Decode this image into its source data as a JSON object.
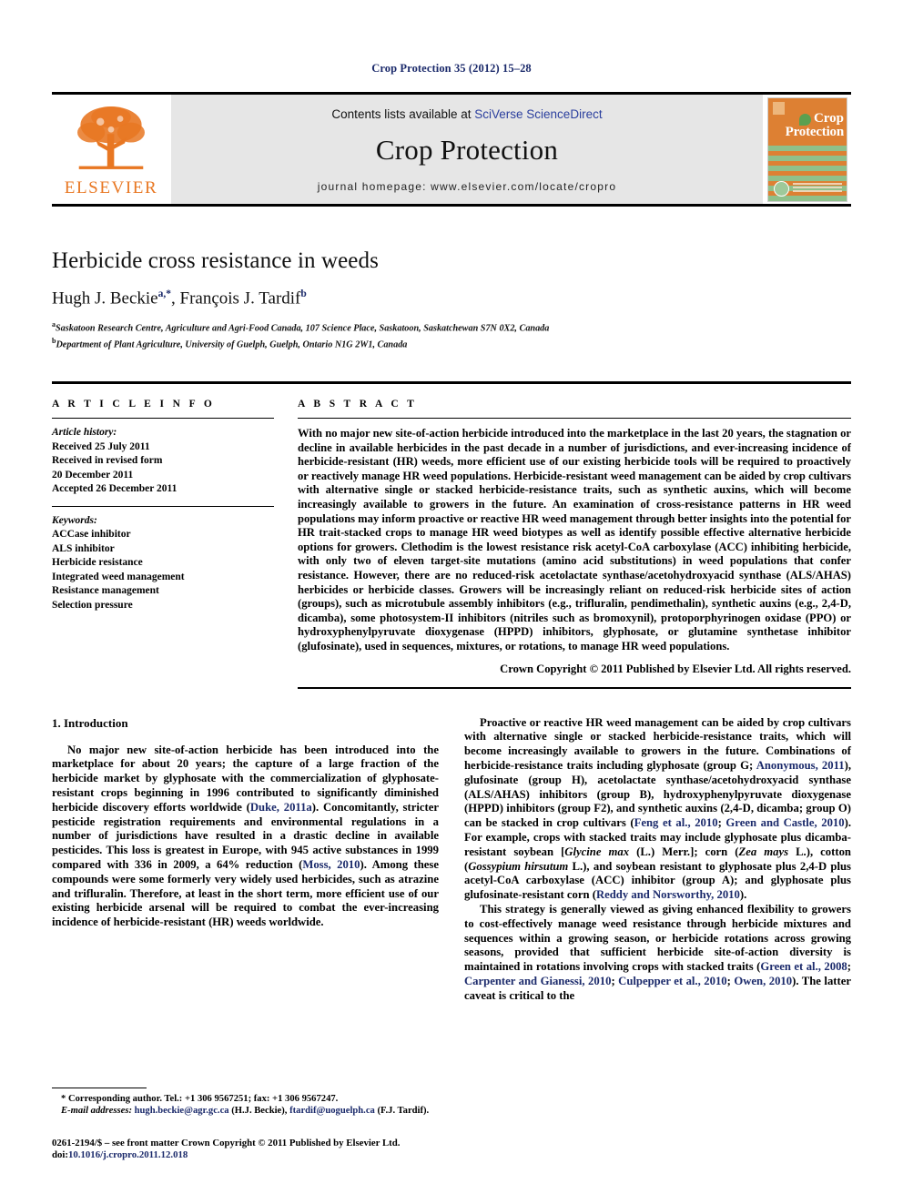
{
  "running_head": "Crop Protection 35 (2012) 15–28",
  "banner": {
    "publisher_name": "ELSEVIER",
    "contents_prefix": "Contents lists available at ",
    "contents_link": "SciVerse ScienceDirect",
    "journal_title": "Crop Protection",
    "homepage": "journal homepage: www.elsevier.com/locate/cropro",
    "cover_title_line1": "Crop",
    "cover_title_line2": "Protection"
  },
  "article": {
    "title": "Herbicide cross resistance in weeds",
    "authors": "Hugh J. Beckie ᵃ,*, François J. Tardif ᵇ",
    "author1_name": "Hugh J. Beckie",
    "author1_marks": "a,*",
    "author2_name": ", François J. Tardif",
    "author2_marks": "b",
    "affiliation_a": "Saskatoon Research Centre, Agriculture and Agri-Food Canada, 107 Science Place, Saskatoon, Saskatchewan S7N 0X2, Canada",
    "affiliation_b": "Department of Plant Agriculture, University of Guelph, Guelph, Ontario N1G 2W1, Canada"
  },
  "article_info": {
    "heading": "A R T I C L E  I N F O",
    "history_label": "Article history:",
    "history": [
      "Received 25 July 2011",
      "Received in revised form",
      "20 December 2011",
      "Accepted 26 December 2011"
    ],
    "keywords_label": "Keywords:",
    "keywords": [
      "ACCase inhibitor",
      "ALS inhibitor",
      "Herbicide resistance",
      "Integrated weed management",
      "Resistance management",
      "Selection pressure"
    ]
  },
  "abstract": {
    "heading": "A B S T R A C T",
    "text": "With no major new site-of-action herbicide introduced into the marketplace in the last 20 years, the stagnation or decline in available herbicides in the past decade in a number of jurisdictions, and ever-increasing incidence of herbicide-resistant (HR) weeds, more efficient use of our existing herbicide tools will be required to proactively or reactively manage HR weed populations. Herbicide-resistant weed management can be aided by crop cultivars with alternative single or stacked herbicide-resistance traits, such as synthetic auxins, which will become increasingly available to growers in the future. An examination of cross-resistance patterns in HR weed populations may inform proactive or reactive HR weed management through better insights into the potential for HR trait-stacked crops to manage HR weed biotypes as well as identify possible effective alternative herbicide options for growers. Clethodim is the lowest resistance risk acetyl-CoA carboxylase (ACC) inhibiting herbicide, with only two of eleven target-site mutations (amino acid substitutions) in weed populations that confer resistance. However, there are no reduced-risk acetolactate synthase/acetohydroxyacid synthase (ALS/AHAS) herbicides or herbicide classes. Growers will be increasingly reliant on reduced-risk herbicide sites of action (groups), such as microtubule assembly inhibitors (e.g., trifluralin, pendimethalin), synthetic auxins (e.g., 2,4-D, dicamba), some photosystem-II inhibitors (nitriles such as bromoxynil), protoporphyrinogen oxidase (PPO) or hydroxyphenylpyruvate dioxygenase (HPPD) inhibitors, glyphosate, or glutamine synthetase inhibitor (glufosinate), used in sequences, mixtures, or rotations, to manage HR weed populations.",
    "copyright": "Crown Copyright © 2011 Published by Elsevier Ltd. All rights reserved."
  },
  "introduction": {
    "heading": "1. Introduction",
    "left_paragraphs": [
      "No major new site-of-action herbicide has been introduced into the marketplace for about 20 years; the capture of a large fraction of the herbicide market by glyphosate with the commercialization of glyphosate-resistant crops beginning in 1996 contributed to significantly diminished herbicide discovery efforts worldwide (Duke, 2011a). Concomitantly, stricter pesticide registration requirements and environmental regulations in a number of jurisdictions have resulted in a drastic decline in available pesticides. This loss is greatest in Europe, with 945 active substances in 1999 compared with 336 in 2009, a 64% reduction (Moss, 2010). Among these compounds were some formerly very widely used herbicides, such as atrazine and trifluralin. Therefore, at least in the short term, more efficient use of our existing herbicide arsenal will be required to combat the ever-increasing incidence of herbicide-resistant (HR) weeds worldwide."
    ],
    "right_paragraphs": [
      "Proactive or reactive HR weed management can be aided by crop cultivars with alternative single or stacked herbicide-resistance traits, which will become increasingly available to growers in the future. Combinations of herbicide-resistance traits including glyphosate (group G; Anonymous, 2011), glufosinate (group H), acetolactate synthase/acetohydroxyacid synthase (ALS/AHAS) inhibitors (group B), hydroxyphenylpyruvate dioxygenase (HPPD) inhibitors (group F2), and synthetic auxins (2,4-D, dicamba; group O) can be stacked in crop cultivars (Feng et al., 2010; Green and Castle, 2010). For example, crops with stacked traits may include glyphosate plus dicamba-resistant soybean [Glycine max (L.) Merr.]; corn (Zea mays L.), cotton (Gossypium hirsutum L.), and soybean resistant to glyphosate plus 2,4-D plus acetyl-CoA carboxylase (ACC) inhibitor (group A); and glyphosate plus glufosinate-resistant corn (Reddy and Norsworthy, 2010).",
      "This strategy is generally viewed as giving enhanced flexibility to growers to cost-effectively manage weed resistance through herbicide mixtures and sequences within a growing season, or herbicide rotations across growing seasons, provided that sufficient herbicide site-of-action diversity is maintained in rotations involving crops with stacked traits (Green et al., 2008; Carpenter and Gianessi, 2010; Culpepper et al., 2010; Owen, 2010). The latter caveat is critical to the"
    ]
  },
  "footnotes": {
    "corresponding": "* Corresponding author. Tel.: +1 306 9567251; fax: +1 306 9567247.",
    "email_label": "E-mail addresses:",
    "email1": "hugh.beckie@agr.gc.ca",
    "email1_owner": "(H.J. Beckie),",
    "email2": "ftardif@uoguelph.ca",
    "email2_owner": "(F.J. Tardif).",
    "issn_line": "0261-2194/$ – see front matter Crown Copyright © 2011 Published by Elsevier Ltd.",
    "doi_label": "doi:",
    "doi_value": "10.1016/j.cropro.2011.12.018"
  },
  "colors": {
    "link_blue": "#1b2a6b",
    "elsevier_orange": "#e87722",
    "banner_gray": "#e6e6e6",
    "cover_orange": "#dd8033",
    "cover_green": "#8fc08a"
  }
}
